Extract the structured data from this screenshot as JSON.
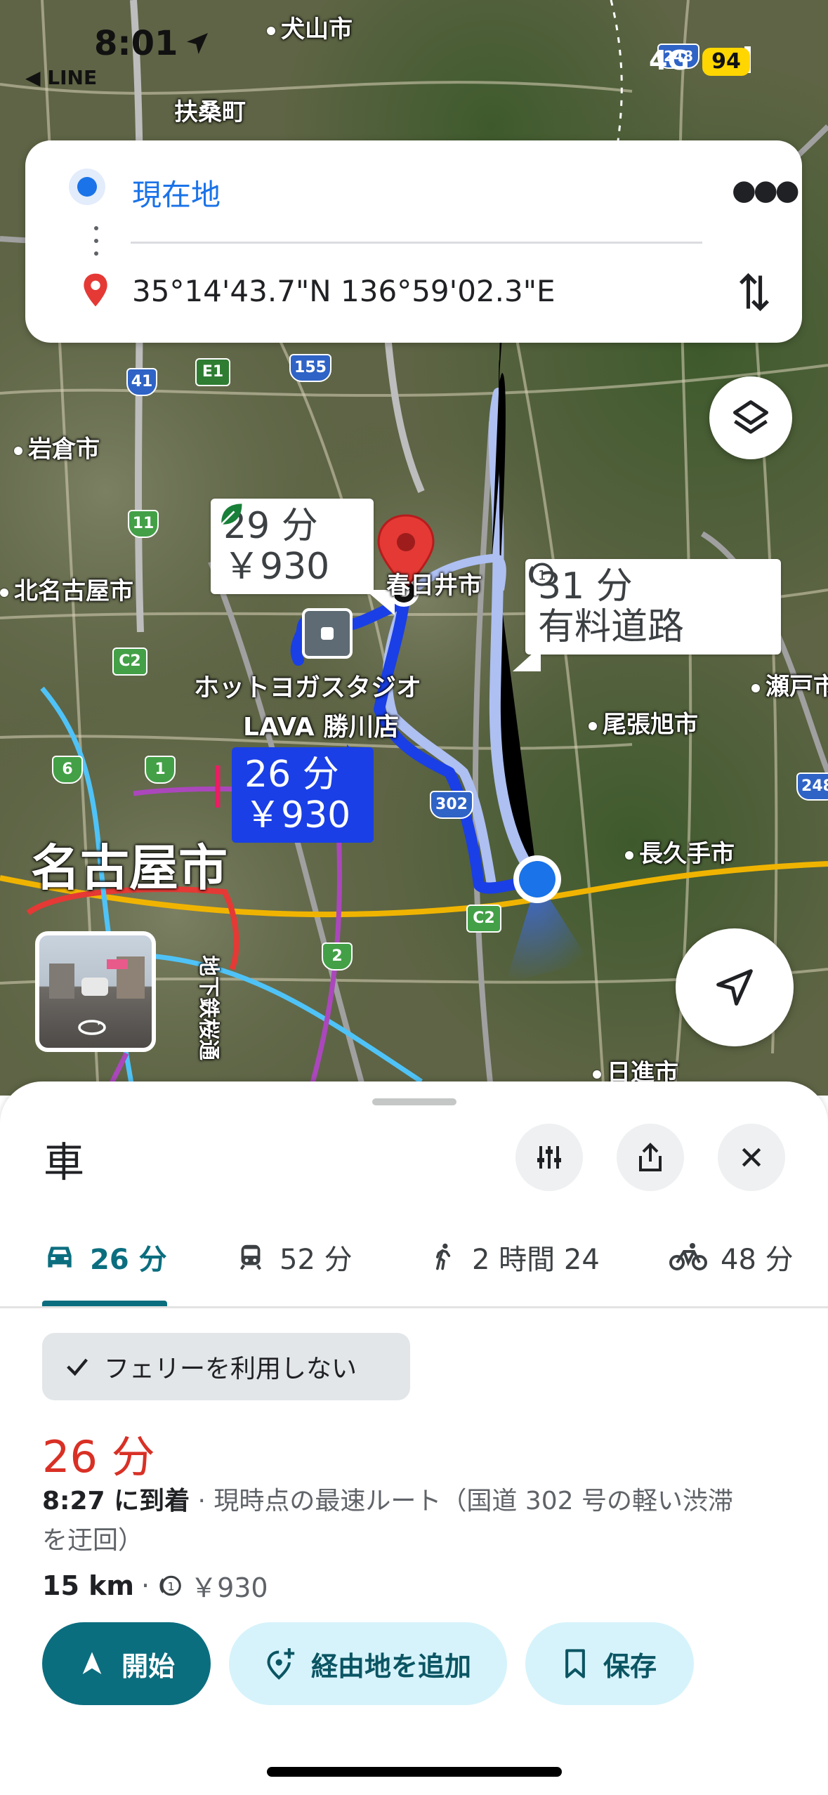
{
  "status_bar": {
    "time": "8:01",
    "back_app": "◀ LINE",
    "network": "4G",
    "battery": "94"
  },
  "directions_card": {
    "origin": "現在地",
    "destination": "35°14'43.7\"N 136°59'02.3\"E"
  },
  "map": {
    "place_labels": {
      "inuyama": "犬山市",
      "fuso": "扶桑町",
      "iwakura": "岩倉市",
      "kitanagoya": "北名古屋市",
      "kasugai": "春日井市",
      "seto": "瀬戸市",
      "owariasahi": "尾張旭市",
      "nagakute": "長久手市",
      "nagoya": "名古屋市",
      "nisshin": "日進市",
      "hotyoga": "ホットヨガスタジオ",
      "lava": "LAVA 勝川店",
      "subway": "地下鉄桜通"
    },
    "road_shields": {
      "r41": "41",
      "e1": "E1",
      "r155": "155",
      "r11": "11",
      "c2a": "C2",
      "r6": "6",
      "r1": "1",
      "r302": "302",
      "c2b": "C2",
      "r2": "2",
      "r248a": "248",
      "r248b": "248"
    },
    "routes": [
      {
        "time": "29 分",
        "toll": "￥930",
        "eco": true
      },
      {
        "time": "31 分",
        "note": "有料道路"
      },
      {
        "time": "26 分",
        "toll": "￥930",
        "selected": true
      }
    ],
    "colors": {
      "route_selected": "#1a3fe6",
      "route_alt": "#aebff2",
      "pin": "#e53935",
      "location": "#1a73e8"
    }
  },
  "sheet": {
    "mode_title": "車",
    "tabs": [
      {
        "icon": "car-icon",
        "label": "26 分",
        "active": true
      },
      {
        "icon": "train-icon",
        "label": "52 分"
      },
      {
        "icon": "walk-icon",
        "label": "2 時間 24"
      },
      {
        "icon": "bike-icon",
        "label": "48 分"
      }
    ],
    "filter_chip": "フェリーを利用しない",
    "duration": "26 分",
    "arrival": "8:27 に到着",
    "route_desc_1": "· 現時点の最速ルート（国道 302 号の軽い渋滞",
    "route_desc_2": "を迂回）",
    "distance": "15 km",
    "toll_cost": "￥930",
    "buttons": {
      "start": "開始",
      "add_stop": "経由地を追加",
      "save": "保存"
    },
    "colors": {
      "accent": "#0b6e7f",
      "duration": "#d93025",
      "pill_bg": "#d6f3fb"
    }
  }
}
